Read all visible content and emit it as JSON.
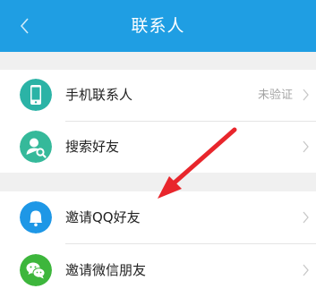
{
  "header": {
    "title": "联系人",
    "back_icon": "chevron-left-icon"
  },
  "groups": [
    {
      "items": [
        {
          "label": "手机联系人",
          "status": "未验证",
          "icon": "phone-icon",
          "icon_color": "#2bb3a6"
        },
        {
          "label": "搜索好友",
          "icon": "search-person-icon",
          "icon_color": "#35b99a"
        }
      ]
    },
    {
      "items": [
        {
          "label": "邀请QQ好友",
          "icon": "qq-bell-icon",
          "icon_color": "#1e97e6"
        },
        {
          "label": "邀请微信朋友",
          "icon": "wechat-icon",
          "icon_color": "#3db63c"
        }
      ]
    }
  ],
  "colors": {
    "header_bg": "#1f9ee3",
    "page_bg": "#f0f0f0",
    "annotation_arrow": "#e8262c"
  }
}
